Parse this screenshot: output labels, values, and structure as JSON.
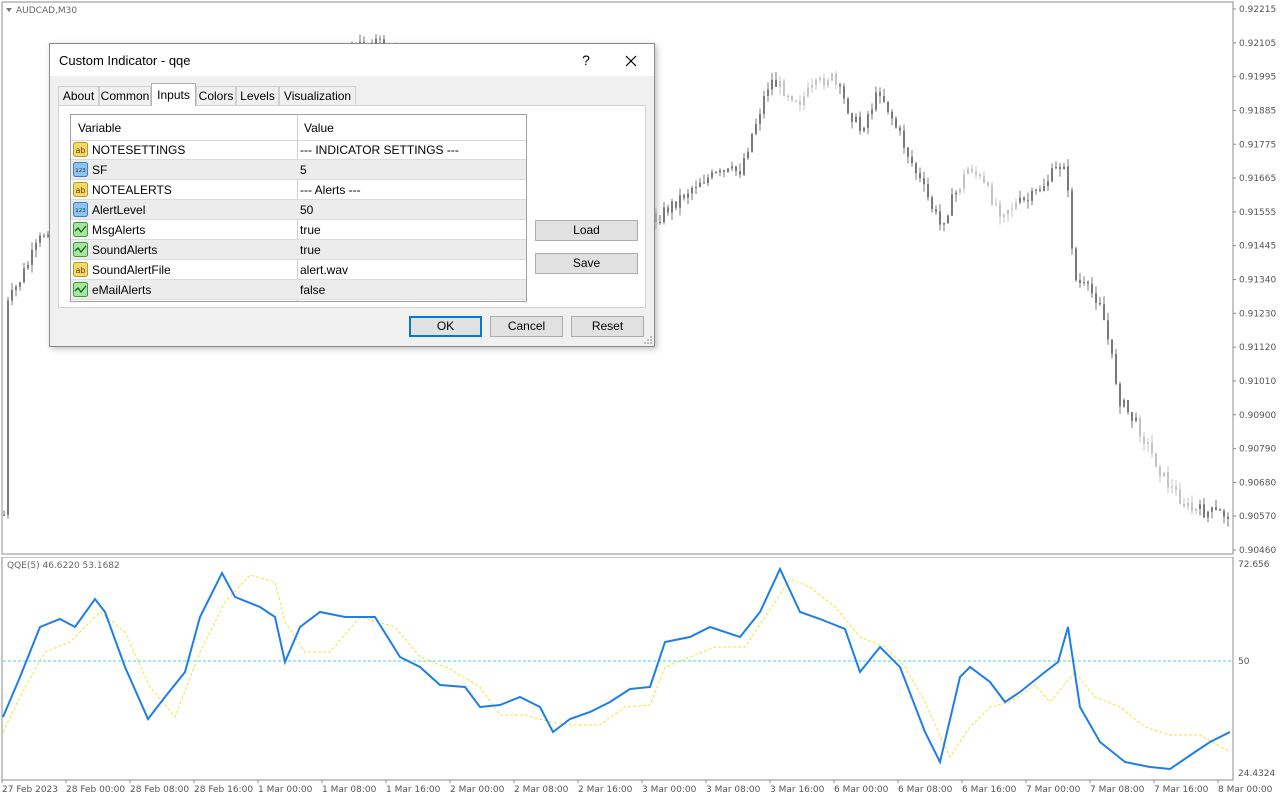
{
  "chart": {
    "symbol_label": "AUDCAD,M30",
    "price_axis": [
      "0.92215",
      "0.92105",
      "0.91995",
      "0.91885",
      "0.91775",
      "0.91665",
      "0.91555",
      "0.91445",
      "0.91340",
      "0.91230",
      "0.91120",
      "0.91010",
      "0.90900",
      "0.90790",
      "0.90680",
      "0.90570",
      "0.90460"
    ],
    "time_axis": [
      "27 Feb 2023",
      "28 Feb 00:00",
      "28 Feb 08:00",
      "28 Feb 16:00",
      "1 Mar 00:00",
      "1 Mar 08:00",
      "1 Mar 16:00",
      "2 Mar 00:00",
      "2 Mar 08:00",
      "2 Mar 16:00",
      "3 Mar 00:00",
      "3 Mar 08:00",
      "3 Mar 16:00",
      "6 Mar 00:00",
      "6 Mar 08:00",
      "6 Mar 16:00",
      "7 Mar 00:00",
      "7 Mar 08:00",
      "7 Mar 16:00",
      "8 Mar 00:00"
    ],
    "candle_color": "#7a7a7a",
    "candle_light_color": "#c4c4c4"
  },
  "indicator": {
    "label": "QQE(5) 46.6220 53.1682",
    "axis": [
      "72.656",
      "50",
      "24.4324"
    ],
    "level_line_color": "#4dd2e8",
    "main_line_color": "#1e7ee8",
    "signal_line_color": "#f2e33a"
  },
  "dialog": {
    "title": "Custom Indicator - qqe",
    "help": "?",
    "tabs": [
      {
        "label": "About"
      },
      {
        "label": "Common"
      },
      {
        "label": "Inputs"
      },
      {
        "label": "Colors"
      },
      {
        "label": "Levels"
      },
      {
        "label": "Visualization"
      }
    ],
    "active_tab": "Inputs",
    "columns": {
      "variable": "Variable",
      "value": "Value"
    },
    "rows": [
      {
        "icon": "ab",
        "name": "NOTESETTINGS",
        "value": "--- INDICATOR SETTINGS ---"
      },
      {
        "icon": "123",
        "name": "SF",
        "value": "5"
      },
      {
        "icon": "ab",
        "name": "NOTEALERTS",
        "value": "--- Alerts ---"
      },
      {
        "icon": "123",
        "name": "AlertLevel",
        "value": "50"
      },
      {
        "icon": "bool",
        "name": "MsgAlerts",
        "value": "true"
      },
      {
        "icon": "bool",
        "name": "SoundAlerts",
        "value": "true"
      },
      {
        "icon": "ab",
        "name": "SoundAlertFile",
        "value": "alert.wav"
      },
      {
        "icon": "bool",
        "name": "eMailAlerts",
        "value": "false"
      }
    ],
    "buttons": {
      "load": "Load",
      "save": "Save",
      "ok": "OK",
      "cancel": "Cancel",
      "reset": "Reset"
    }
  }
}
